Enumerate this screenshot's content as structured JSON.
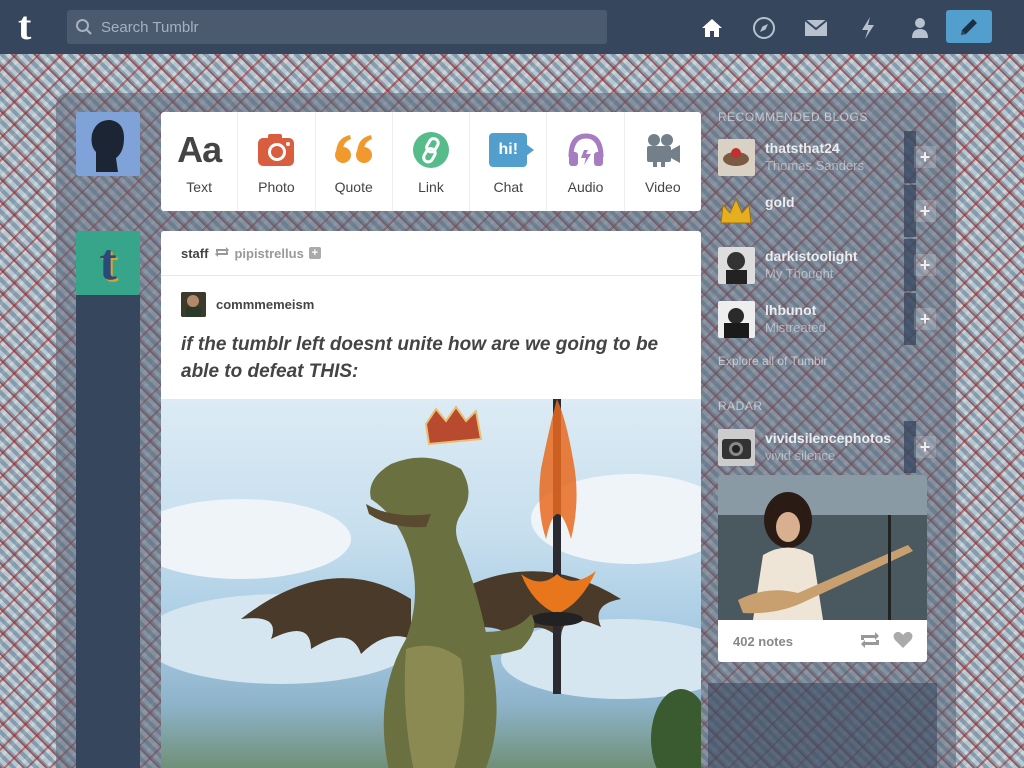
{
  "header": {
    "logo": "t",
    "search_placeholder": "Search Tumblr",
    "nav_icons": [
      "home-icon",
      "explore-compass-icon",
      "inbox-mail-icon",
      "activity-lightning-icon",
      "account-person-icon"
    ],
    "compose_icon": "pencil-icon"
  },
  "post_types": [
    {
      "label": "Text",
      "icon": "Aa",
      "color": "#444444"
    },
    {
      "label": "Photo",
      "icon": "camera-icon",
      "color": "#d95e40"
    },
    {
      "label": "Quote",
      "icon": "quote-icon",
      "color": "#f2992e"
    },
    {
      "label": "Link",
      "icon": "link-icon",
      "color": "#56bc8a"
    },
    {
      "label": "Chat",
      "icon": "hi!",
      "color": "#529ecc"
    },
    {
      "label": "Audio",
      "icon": "headphones-icon",
      "color": "#a77dc2"
    },
    {
      "label": "Video",
      "icon": "video-camera-icon",
      "color": "#748089"
    }
  ],
  "post": {
    "author": "staff",
    "reblogged_from": "pipistrellus",
    "follow_symbol": "+",
    "source_blog": "commmemeism",
    "caption": "if the tumblr left doesnt unite how are we going to be able to defeat THIS:"
  },
  "sidebar": {
    "recommended_title": "RECOMMENDED BLOGS",
    "blogs": [
      {
        "name": "thatsthat24",
        "subtitle": "Thomas Sanders"
      },
      {
        "name": "gold",
        "subtitle": ""
      },
      {
        "name": "darkistoolight",
        "subtitle": "My Thought"
      },
      {
        "name": "lhbunot",
        "subtitle": "Mistreated"
      }
    ],
    "add_symbol": "+",
    "explore_link": "Explore all of Tumblr",
    "radar_title": "RADAR",
    "radar_blog": {
      "name": "vividsilencephotos",
      "subtitle": "vivid silence"
    },
    "radar_notes": "402 notes"
  }
}
